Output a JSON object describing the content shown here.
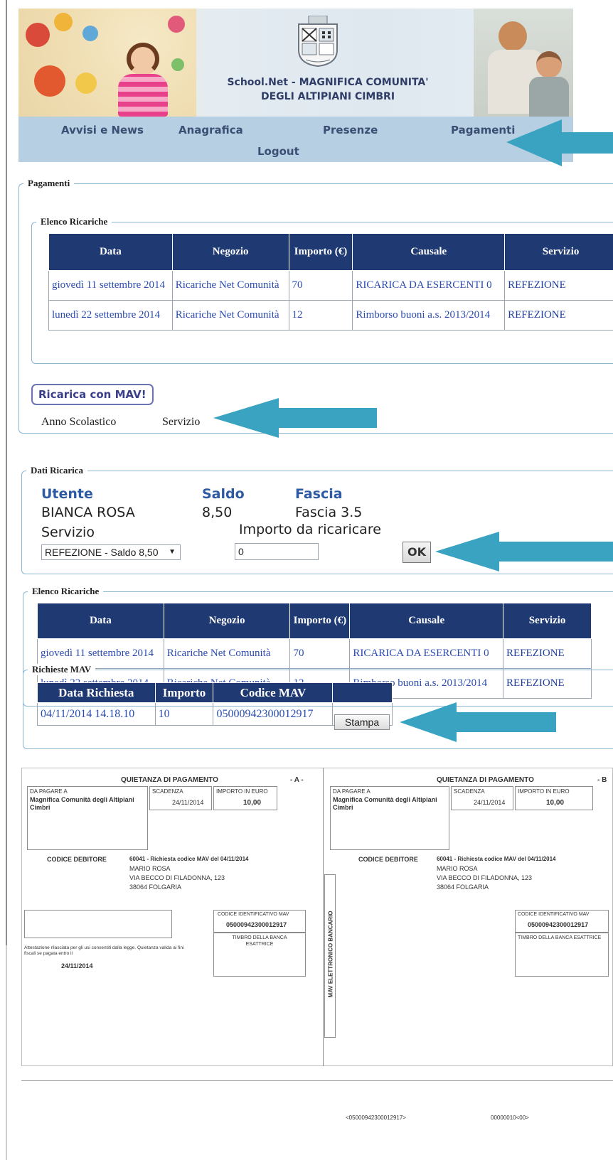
{
  "header": {
    "title_line1": "School.Net - MAGNIFICA COMUNITA'",
    "title_line2": "DEGLI ALTIPIANI CIMBRI"
  },
  "nav": {
    "items": [
      "Avvisi e News",
      "Anagrafica",
      "Presenze",
      "Pagamenti",
      "Logout"
    ]
  },
  "pagamenti": {
    "legend": "Pagamenti",
    "elenco_legend": "Elenco Ricariche",
    "columns": [
      "Data",
      "Negozio",
      "Importo (€)",
      "Causale",
      "Servizio"
    ],
    "rows": [
      {
        "data": "giovedì 11 settembre 2014",
        "negozio": "Ricariche Net Comunità",
        "importo": "70",
        "causale": "RICARICA DA ESERCENTI 0",
        "servizio": "REFEZIONE"
      },
      {
        "data": "lunedì 22 settembre 2014",
        "negozio": "Ricariche Net Comunità",
        "importo": "12",
        "causale": "Rimborso buoni a.s. 2013/2014",
        "servizio": "REFEZIONE"
      }
    ],
    "mav_button": "Ricarica con MAV!",
    "filter_anno": "Anno Scolastico",
    "filter_servizio": "Servizio"
  },
  "dati_ricarica": {
    "legend": "Dati Ricarica",
    "utente_label": "Utente",
    "saldo_label": "Saldo",
    "fascia_label": "Fascia",
    "utente": "BIANCA ROSA",
    "saldo": "8,50",
    "fascia": "Fascia 3.5",
    "servizio_label": "Servizio",
    "importo_label": "Importo da ricaricare",
    "servizio_selected": "REFEZIONE - Saldo 8,50",
    "importo_value": "0",
    "ok_label": "OK"
  },
  "elenco2": {
    "legend": "Elenco Ricariche",
    "columns": [
      "Data",
      "Negozio",
      "Importo (€)",
      "Causale",
      "Servizio"
    ],
    "rows": [
      {
        "data": "giovedì 11 settembre 2014",
        "negozio": "Ricariche Net Comunità",
        "importo": "70",
        "causale": "RICARICA DA ESERCENTI 0",
        "servizio": "REFEZIONE"
      },
      {
        "data": "lunedì 22 settembre 2014",
        "negozio": "Ricariche Net Comunità",
        "importo": "12",
        "causale": "Rimborso buoni a.s. 2013/2014",
        "servizio": "REFEZIONE"
      }
    ]
  },
  "richieste_mav": {
    "legend": "Richieste MAV",
    "columns": [
      "Data Richiesta",
      "Importo",
      "Codice MAV"
    ],
    "row": {
      "data": "04/11/2014 14.18.10",
      "importo": "10",
      "codice": "05000942300012917"
    },
    "stampa": "Stampa"
  },
  "receipt": {
    "title": "QUIETANZA DI PAGAMENTO",
    "tag_a": "- A -",
    "tag_b": "- B",
    "da_pagare_label": "DA PAGARE A",
    "da_pagare": "Magnifica Comunità degli Altipiani Cimbri",
    "scadenza_label": "SCADENZA",
    "scadenza": "24/11/2014",
    "importo_label": "IMPORTO IN EURO",
    "importo": "10,00",
    "codice_debitore_label": "CODICE DEBITORE",
    "codice_debitore": "60041 - Richiesta codice MAV del 04/11/2014",
    "nome": "MARIO ROSA",
    "indirizzo": "VIA BECCO DI FILADONNA, 123",
    "citta": "38064 FOLGARIA",
    "cod_ident_label": "CODICE IDENTIFICATIVO MAV",
    "cod_ident": "05000942300012917",
    "timbro": "TIMBRO DELLA BANCA ESATTRICE",
    "attestazione": "Attestazione rilasciata per gli usi consentiti dalla legge. Quietanza valida ai fini fiscali se pagata entro il",
    "attestazione_date": "24/11/2014",
    "side_label": "MAV ELETTRONICO BANCARIO",
    "bottom_code_left": "<05000942300012917>",
    "bottom_code_right": "00000010<00>"
  },
  "colors": {
    "table_header": "#1f3a73",
    "nav_bg": "#b7cfe2",
    "fieldset_border": "#8ab6d2",
    "arrow": "#3aa3c1",
    "link_text": "#2a4cb0"
  }
}
